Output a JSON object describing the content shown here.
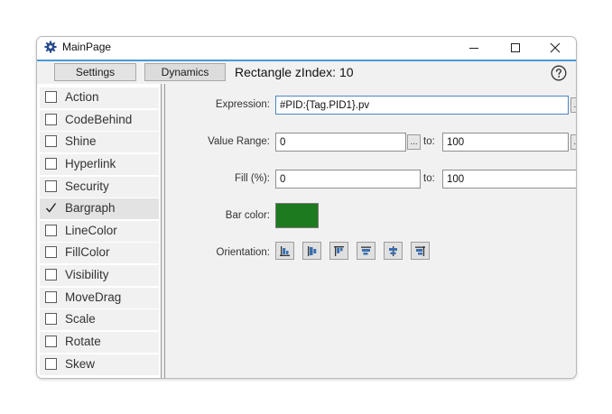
{
  "window": {
    "title": "MainPage",
    "icon": "gear-icon",
    "controls": [
      "minimize-icon",
      "maximize-icon",
      "close-icon"
    ]
  },
  "toolbar": {
    "tabs": [
      {
        "label": "Settings"
      },
      {
        "label": "Dynamics"
      }
    ],
    "title": "Rectangle zIndex: 10",
    "help_icon": "help-icon"
  },
  "dynamics_list": {
    "items": [
      {
        "label": "Action",
        "checked": false
      },
      {
        "label": "CodeBehind",
        "checked": false
      },
      {
        "label": "Shine",
        "checked": false
      },
      {
        "label": "Hyperlink",
        "checked": false
      },
      {
        "label": "Security",
        "checked": false
      },
      {
        "label": "Bargraph",
        "checked": true
      },
      {
        "label": "LineColor",
        "checked": false
      },
      {
        "label": "FillColor",
        "checked": false
      },
      {
        "label": "Visibility",
        "checked": false
      },
      {
        "label": "MoveDrag",
        "checked": false
      },
      {
        "label": "Scale",
        "checked": false
      },
      {
        "label": "Rotate",
        "checked": false
      },
      {
        "label": "Skew",
        "checked": false
      }
    ]
  },
  "bargraph": {
    "expression_label": "Expression:",
    "expression_value": "#PID:{Tag.PID1}.pv",
    "value_range_label": "Value Range:",
    "value_range_from": "0",
    "value_range_to": "100",
    "to_label": "to:",
    "fill_label": "Fill (%):",
    "fill_from": "0",
    "fill_to": "100",
    "dots_label": "...",
    "bar_color_label": "Bar color:",
    "bar_color": "#1e7a1e",
    "orientation_label": "Orientation:",
    "orientations": [
      "align-bottom-left-icon",
      "align-center-left-icon",
      "align-top-left-icon",
      "align-top-icon",
      "align-center-top-icon",
      "align-top-right-icon"
    ]
  },
  "colors": {
    "accent": "#4a9ad8",
    "pane_bg": "#f1f1f1"
  }
}
